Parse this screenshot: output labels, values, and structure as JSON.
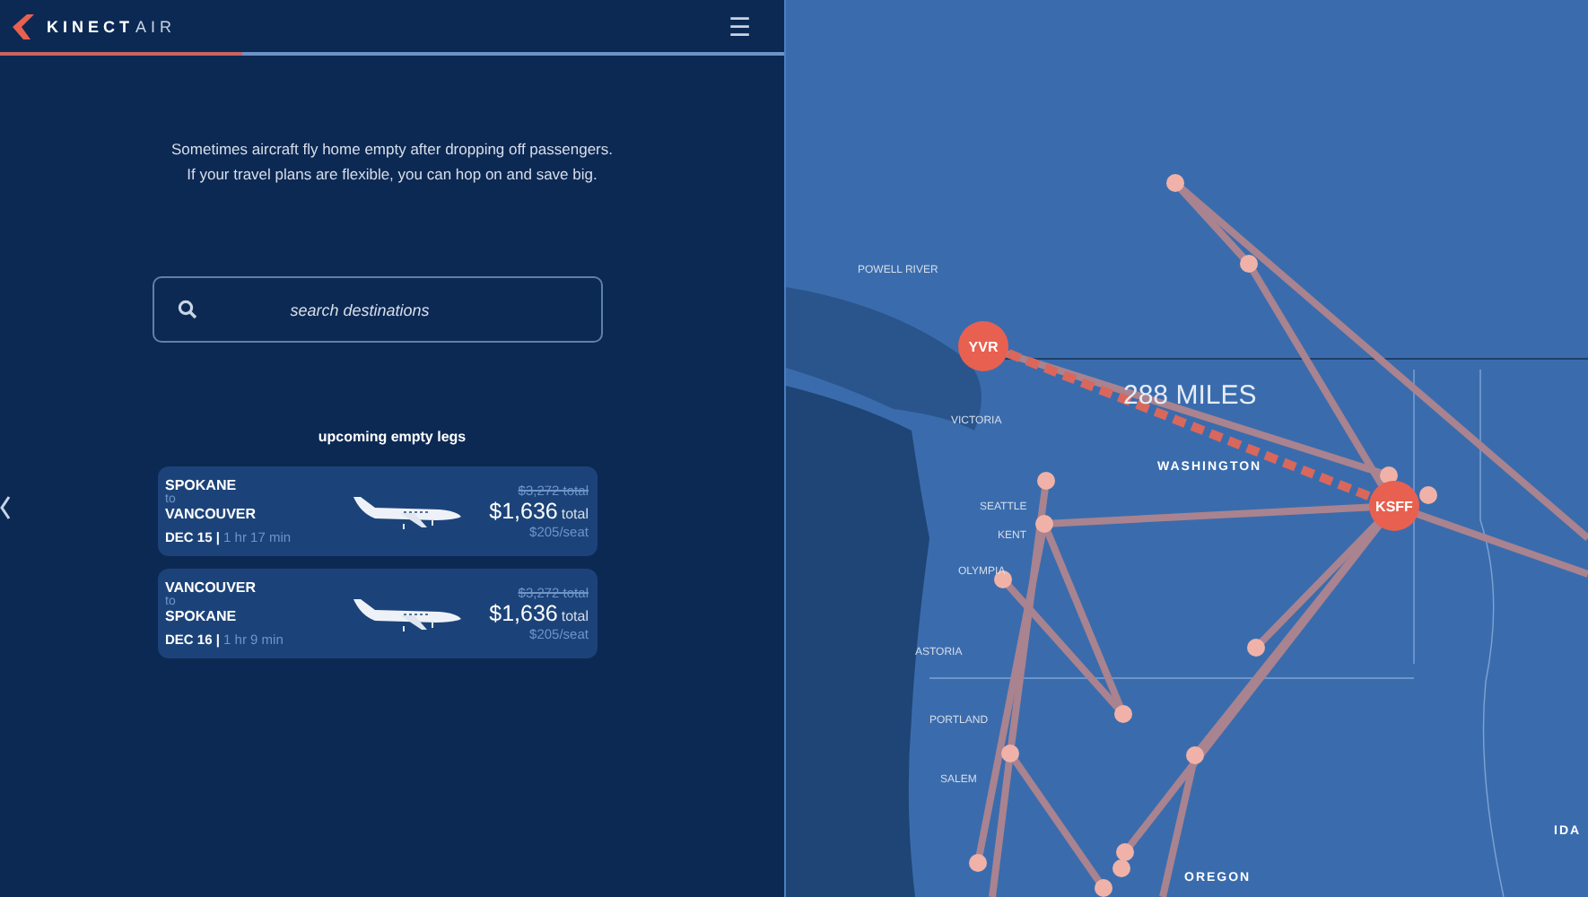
{
  "header": {
    "logo_text": "KINECT",
    "logo_suffix": "AIR",
    "menu_glyph": "☰"
  },
  "progress": {
    "level": 0.31
  },
  "intro": [
    "Sometimes aircraft fly home empty after dropping off passengers.",
    "If your travel plans are flexible, you can hop on and save big."
  ],
  "search": {
    "placeholder": "search destinations"
  },
  "legs_heading": "upcoming empty legs",
  "legs": [
    {
      "origin": "SPOKANE",
      "connector": "to",
      "destination": "VANCOUVER",
      "date_line": "**DEC 15 |** 1 hr 17 min",
      "old_price": "$3,272 total",
      "price": "$1,636",
      "price_suffix": "total",
      "per_seat": "$205/seat"
    },
    {
      "origin": "VANCOUVER",
      "connector": "to",
      "destination": "SPOKANE",
      "date_line": "**DEC 16 |** 1 hr 9 min",
      "old_price": "$3,272 total",
      "price": "$1,636",
      "price_suffix": "total",
      "per_seat": "$205/seat"
    }
  ],
  "map": {
    "distance": "288 MILES",
    "airports": [
      {
        "code": "YVR"
      },
      {
        "code": "KSFF"
      }
    ],
    "labels": [
      {
        "text": "POWELL RIVER",
        "kind": "city"
      },
      {
        "text": "VICTORIA",
        "kind": "city"
      },
      {
        "text": "WASHINGTON",
        "kind": "region"
      },
      {
        "text": "SEATTLE",
        "kind": "city"
      },
      {
        "text": "KENT",
        "kind": "city"
      },
      {
        "text": "OLYMPIA",
        "kind": "city"
      },
      {
        "text": "ASTORIA",
        "kind": "city"
      },
      {
        "text": "PORTLAND",
        "kind": "city"
      },
      {
        "text": "SALEM",
        "kind": "city"
      },
      {
        "text": "OREGON",
        "kind": "region"
      },
      {
        "text": "IDA",
        "kind": "region"
      }
    ]
  }
}
